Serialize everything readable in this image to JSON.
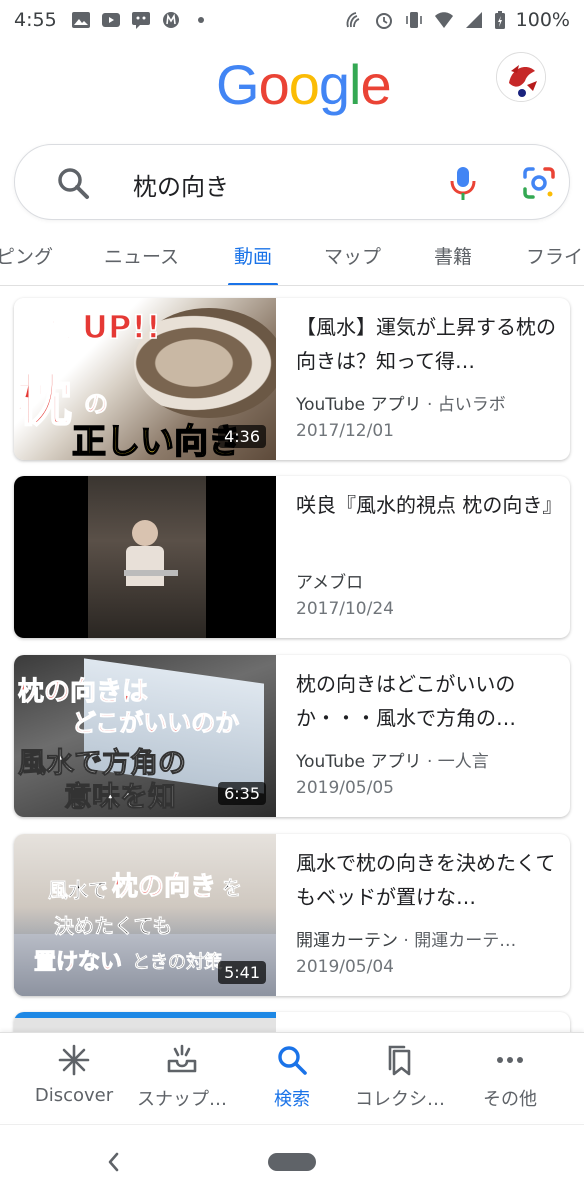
{
  "status_bar": {
    "time": "4:55",
    "battery": "100%"
  },
  "header": {
    "logo_letters": [
      "G",
      "o",
      "o",
      "g",
      "l",
      "e"
    ],
    "logo_colors": [
      "#4285F4",
      "#EA4335",
      "#FBBC05",
      "#4285F4",
      "#34A853",
      "#EA4335"
    ]
  },
  "search": {
    "query": "枕の向き"
  },
  "tabs": [
    {
      "label": "ピング",
      "active": false
    },
    {
      "label": "ニュース",
      "active": false
    },
    {
      "label": "動画",
      "active": true
    },
    {
      "label": "マップ",
      "active": false
    },
    {
      "label": "書籍",
      "active": false
    },
    {
      "label": "フライ",
      "active": false
    }
  ],
  "results": [
    {
      "title": "【風水】運気が上昇する枕の向きは？知って得…",
      "source": "YouTube アプリ",
      "channel": "· 占いラボ",
      "date": "2017/12/01",
      "duration": "4:36",
      "thumb_text": [
        "運気UP!!",
        "枕",
        "の",
        "正しい向き"
      ]
    },
    {
      "title": "咲良『風水的視点 枕の向き』",
      "source": "アメブロ",
      "channel": "",
      "date": "2017/10/24",
      "duration": "",
      "thumb_text": []
    },
    {
      "title": "枕の向きはどこがいいのか・・・風水で方角の…",
      "source": "YouTube アプリ",
      "channel": "· 一人言",
      "date": "2019/05/05",
      "duration": "6:35",
      "thumb_text": [
        "枕の向きは",
        "どこがいいのか",
        "風水で方角の",
        "意味を知"
      ]
    },
    {
      "title": "風水で枕の向きを決めたくてもベッドが置けな…",
      "source": "開運カーテン",
      "channel": "· 開運カーテ…",
      "date": "2019/05/04",
      "duration": "5:41",
      "thumb_text": [
        "風水で",
        "枕の向き",
        "を",
        "決めたくても",
        "置けない",
        "ときの対策"
      ]
    }
  ],
  "bottom_nav": [
    {
      "label": "Discover",
      "icon": "asterisk-icon",
      "active": false
    },
    {
      "label": "スナップ…",
      "icon": "snapshot-inbox-icon",
      "active": false
    },
    {
      "label": "検索",
      "icon": "search-icon",
      "active": true
    },
    {
      "label": "コレクシ…",
      "icon": "bookmark-collections-icon",
      "active": false
    },
    {
      "label": "その他",
      "icon": "more-dots-icon",
      "active": false
    }
  ],
  "colors": {
    "accent": "#1a73e8",
    "text_primary": "#202124",
    "text_secondary": "#5f6368"
  }
}
